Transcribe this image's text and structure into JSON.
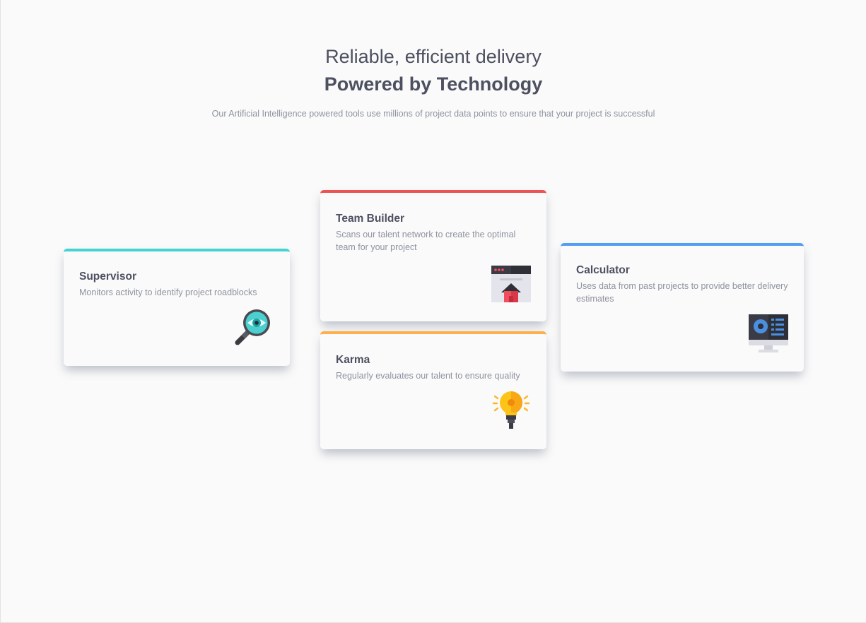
{
  "header": {
    "tagline": "Reliable, efficient delivery",
    "heading": "Powered by Technology",
    "subtitle": "Our Artificial Intelligence powered tools use millions of project data points to ensure that your project is successful"
  },
  "cards": {
    "supervisor": {
      "title": "Supervisor",
      "description": "Monitors activity to identify project roadblocks",
      "icon": "magnifier-eye-icon",
      "accent": "#44d3d2"
    },
    "team_builder": {
      "title": "Team Builder",
      "description": "Scans our talent network to create the optimal team for your project",
      "icon": "browser-house-icon",
      "accent": "#ea5454"
    },
    "karma": {
      "title": "Karma",
      "description": "Regularly evaluates our talent to ensure quality",
      "icon": "lightbulb-icon",
      "accent": "#fcaf4a"
    },
    "calculator": {
      "title": "Calculator",
      "description": "Uses data from past projects to provide better delivery estimates",
      "icon": "monitor-chart-icon",
      "accent": "#549ef2"
    }
  }
}
